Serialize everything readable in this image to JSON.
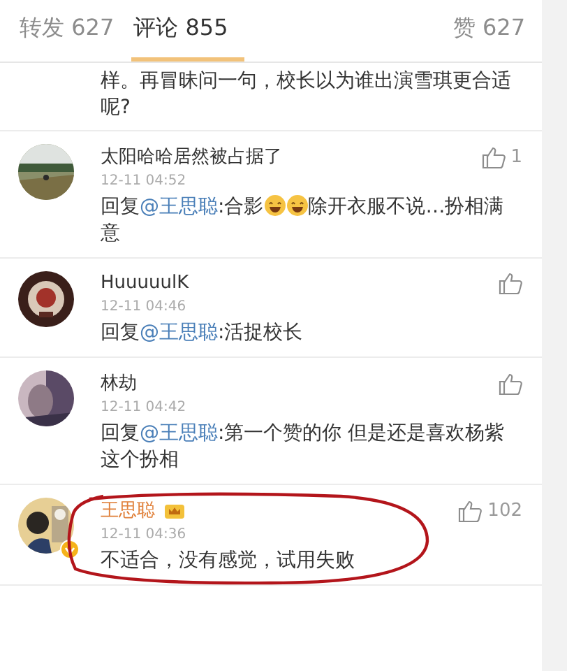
{
  "tabs": [
    {
      "label": "转发 627",
      "selected": false
    },
    {
      "label": "评论 855",
      "selected": true
    },
    {
      "label": "赞 627",
      "selected": false
    }
  ],
  "partial_comment": {
    "text": "样。再冒昧问一句，校长以为谁出演雪琪更合适呢?"
  },
  "comments": [
    {
      "name": "太阳哈哈居然被占据了",
      "vip": false,
      "verified": false,
      "time": "12-11 04:52",
      "likes": "1",
      "circled": false,
      "body": [
        {
          "kind": "text",
          "text": "回复"
        },
        {
          "kind": "mention",
          "text": "@王思聪"
        },
        {
          "kind": "text",
          "text": ":合影"
        },
        {
          "kind": "emoji"
        },
        {
          "kind": "emoji"
        },
        {
          "kind": "text",
          "text": "除开衣服不说…扮相满意"
        }
      ]
    },
    {
      "name": "HuuuuulK",
      "vip": false,
      "verified": false,
      "time": "12-11 04:46",
      "circled": false,
      "body": [
        {
          "kind": "text",
          "text": "回复"
        },
        {
          "kind": "mention",
          "text": "@王思聪"
        },
        {
          "kind": "text",
          "text": ":活捉校长"
        }
      ]
    },
    {
      "name": "林劫",
      "vip": false,
      "verified": false,
      "time": "12-11 04:42",
      "circled": false,
      "body": [
        {
          "kind": "text",
          "text": "回复"
        },
        {
          "kind": "mention",
          "text": "@王思聪"
        },
        {
          "kind": "text",
          "text": ":第一个赞的你 但是还是喜欢杨紫这个扮相"
        }
      ]
    },
    {
      "name": "王思聪",
      "vip": true,
      "verified": true,
      "time": "12-11 04:36",
      "likes": "102",
      "circled": true,
      "body": [
        {
          "kind": "text",
          "text": "不适合，没有感觉，试用失败"
        }
      ]
    }
  ]
}
